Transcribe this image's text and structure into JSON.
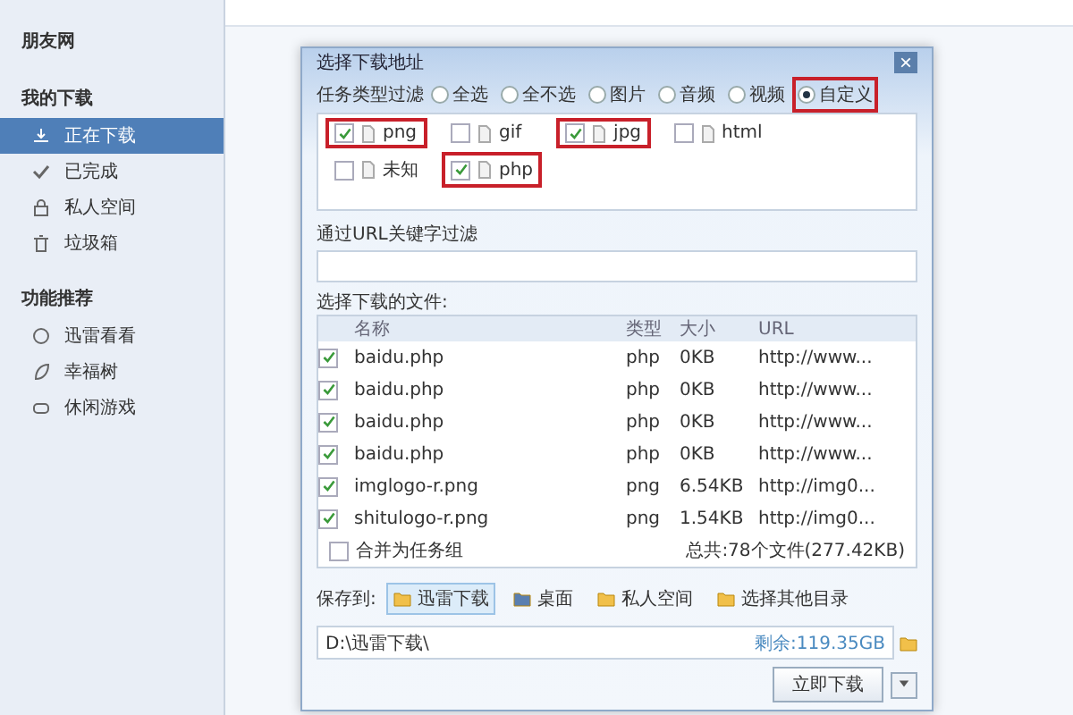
{
  "sidebar": {
    "top_item": "朋友网",
    "sections": [
      {
        "title": "我的下载",
        "items": [
          {
            "label": "正在下载",
            "kind": "download",
            "selected": true
          },
          {
            "label": "已完成",
            "kind": "check",
            "selected": false
          },
          {
            "label": "私人空间",
            "kind": "lock",
            "selected": false
          },
          {
            "label": "垃圾箱",
            "kind": "trash",
            "selected": false
          }
        ]
      },
      {
        "title": "功能推荐",
        "items": [
          {
            "label": "迅雷看看",
            "kind": "play",
            "selected": false
          },
          {
            "label": "幸福树",
            "kind": "leaf",
            "selected": false
          },
          {
            "label": "休闲游戏",
            "kind": "gamepad",
            "selected": false
          }
        ]
      }
    ]
  },
  "dialog": {
    "title": "选择下载地址",
    "close": "×",
    "filter": {
      "label": "任务类型过滤",
      "options": [
        {
          "label": "全选",
          "selected": false,
          "highlighted": false
        },
        {
          "label": "全不选",
          "selected": false,
          "highlighted": false
        },
        {
          "label": "图片",
          "selected": false,
          "highlighted": false
        },
        {
          "label": "音频",
          "selected": false,
          "highlighted": false
        },
        {
          "label": "视频",
          "selected": false,
          "highlighted": false
        },
        {
          "label": "自定义",
          "selected": true,
          "highlighted": true
        }
      ]
    },
    "types": [
      {
        "label": "png",
        "checked": true,
        "highlighted": true
      },
      {
        "label": "gif",
        "checked": false,
        "highlighted": false
      },
      {
        "label": "jpg",
        "checked": true,
        "highlighted": true
      },
      {
        "label": "html",
        "checked": false,
        "highlighted": false
      },
      {
        "label": "未知",
        "checked": false,
        "highlighted": false
      },
      {
        "label": "php",
        "checked": true,
        "highlighted": true
      }
    ],
    "url_filter": {
      "label": "通过URL关键字过滤"
    },
    "files": {
      "label": "选择下载的文件:",
      "columns": [
        "名称",
        "类型",
        "大小",
        "URL"
      ],
      "rows": [
        {
          "checked": true,
          "name": "baidu.php",
          "type": "php",
          "size": "0KB",
          "url": "http://www..."
        },
        {
          "checked": true,
          "name": "baidu.php",
          "type": "php",
          "size": "0KB",
          "url": "http://www..."
        },
        {
          "checked": true,
          "name": "baidu.php",
          "type": "php",
          "size": "0KB",
          "url": "http://www..."
        },
        {
          "checked": true,
          "name": "baidu.php",
          "type": "php",
          "size": "0KB",
          "url": "http://www..."
        },
        {
          "checked": true,
          "name": "imglogo-r.png",
          "type": "png",
          "size": "6.54KB",
          "url": "http://img0..."
        },
        {
          "checked": true,
          "name": "shitulogo-r.png",
          "type": "png",
          "size": "1.54KB",
          "url": "http://img0..."
        }
      ],
      "merge": {
        "label": "合并为任务组",
        "checked": false
      },
      "total": "总共:78个文件(277.42KB)"
    },
    "save": {
      "label": "保存到:",
      "options": [
        {
          "label": "迅雷下载",
          "selected": true
        },
        {
          "label": "桌面",
          "selected": false
        },
        {
          "label": "私人空间",
          "selected": false
        },
        {
          "label": "选择其他目录",
          "selected": false
        }
      ],
      "path": "D:\\迅雷下载\\",
      "free": "剩余:119.35GB"
    },
    "button": "立即下载"
  }
}
